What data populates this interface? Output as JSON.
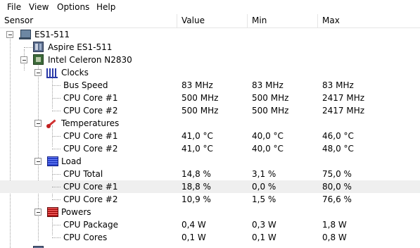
{
  "menu": [
    "File",
    "View",
    "Options",
    "Help"
  ],
  "columns": {
    "sensor": "Sensor",
    "value": "Value",
    "min": "Min",
    "max": "Max"
  },
  "rows": [
    {
      "label": "ES1-511",
      "value": "",
      "min": "",
      "max": "",
      "icon": "computer-icon"
    },
    {
      "label": "Aspire ES1-511",
      "value": "",
      "min": "",
      "max": "",
      "icon": "motherboard-icon"
    },
    {
      "label": "Intel Celeron N2830",
      "value": "",
      "min": "",
      "max": "",
      "icon": "cpu-icon"
    },
    {
      "label": "Clocks",
      "value": "",
      "min": "",
      "max": "",
      "icon": "clock-icon"
    },
    {
      "label": "Bus Speed",
      "value": "83 MHz",
      "min": "83 MHz",
      "max": "83 MHz"
    },
    {
      "label": "CPU Core #1",
      "value": "500 MHz",
      "min": "500 MHz",
      "max": "2417 MHz"
    },
    {
      "label": "CPU Core #2",
      "value": "500 MHz",
      "min": "500 MHz",
      "max": "2417 MHz"
    },
    {
      "label": "Temperatures",
      "value": "",
      "min": "",
      "max": "",
      "icon": "thermometer-icon"
    },
    {
      "label": "CPU Core #1",
      "value": "41,0 °C",
      "min": "40,0 °C",
      "max": "46,0 °C"
    },
    {
      "label": "CPU Core #2",
      "value": "41,0 °C",
      "min": "40,0 °C",
      "max": "48,0 °C"
    },
    {
      "label": "Load",
      "value": "",
      "min": "",
      "max": "",
      "icon": "load-icon"
    },
    {
      "label": "CPU Total",
      "value": "14,8 %",
      "min": "3,1 %",
      "max": "75,0 %"
    },
    {
      "label": "CPU Core #1",
      "value": "18,8 %",
      "min": "0,0 %",
      "max": "80,0 %"
    },
    {
      "label": "CPU Core #2",
      "value": "10,9 %",
      "min": "1,5 %",
      "max": "76,6 %"
    },
    {
      "label": "Powers",
      "value": "",
      "min": "",
      "max": "",
      "icon": "power-icon"
    },
    {
      "label": "CPU Package",
      "value": "0,4 W",
      "min": "0,3 W",
      "max": "1,8 W"
    },
    {
      "label": "CPU Cores",
      "value": "0,1 W",
      "min": "0,1 W",
      "max": "0,8 W"
    }
  ]
}
